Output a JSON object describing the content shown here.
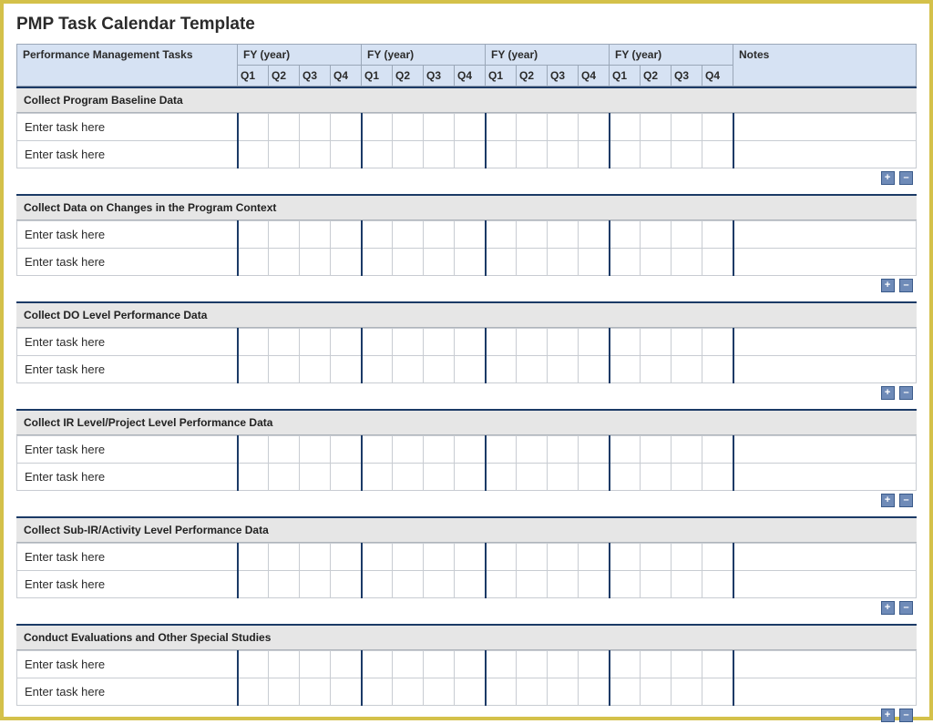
{
  "title": "PMP Task Calendar Template",
  "header": {
    "tasks_label": "Performance Management Tasks",
    "fy_label": "FY  (year)",
    "notes_label": "Notes",
    "q1": "Q1",
    "q2": "Q2",
    "q3": "Q3",
    "q4": "Q4"
  },
  "placeholder": "Enter task here",
  "controls": {
    "plus": "+",
    "minus": "–"
  },
  "sections": [
    {
      "title": "Collect Program Baseline Data"
    },
    {
      "title": "Collect Data on Changes in the Program Context"
    },
    {
      "title": "Collect DO Level Performance Data"
    },
    {
      "title": "Collect IR Level/Project Level Performance Data"
    },
    {
      "title": "Collect Sub-IR/Activity Level Performance Data"
    },
    {
      "title": "Conduct Evaluations and Other Special Studies"
    }
  ]
}
